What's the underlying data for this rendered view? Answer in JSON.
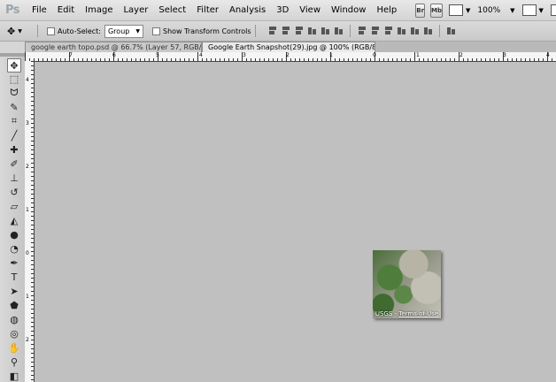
{
  "app": {
    "logo": "Ps"
  },
  "menu": [
    "File",
    "Edit",
    "Image",
    "Layer",
    "Select",
    "Filter",
    "Analysis",
    "3D",
    "View",
    "Window",
    "Help"
  ],
  "menubar_buttons": {
    "bridge": "Br",
    "minibridge": "Mb"
  },
  "zoom": "100%",
  "options": {
    "auto_select_label": "Auto-Select:",
    "auto_select_value": "Group",
    "show_transform_label": "Show Transform Controls"
  },
  "tabs": [
    {
      "label": "google earth topo.psd @ 66.7% (Layer 57, RGB/8) *",
      "active": false
    },
    {
      "label": "Google Earth Snapshot(29).jpg @ 100% (RGB/8#)",
      "active": true
    }
  ],
  "ruler": {
    "h_labels": [
      "7",
      "6",
      "5",
      "4",
      "3",
      "2",
      "1",
      "0",
      "1",
      "2",
      "3",
      "4"
    ],
    "v_labels": [
      "4",
      "3",
      "2",
      "1",
      "0",
      "1",
      "2"
    ]
  },
  "document": {
    "caption_source": "USGS",
    "caption_sep": " - ",
    "caption_terms": "Terms of Use"
  },
  "tools": [
    {
      "name": "move-tool",
      "glyph": "✥",
      "selected": true
    },
    {
      "name": "marquee-tool",
      "glyph": "⬚"
    },
    {
      "name": "lasso-tool",
      "glyph": "ᗢ"
    },
    {
      "name": "quick-select-tool",
      "glyph": "✎"
    },
    {
      "name": "crop-tool",
      "glyph": "⌗"
    },
    {
      "name": "eyedropper-tool",
      "glyph": "╱"
    },
    {
      "name": "spot-healing-tool",
      "glyph": "✚"
    },
    {
      "name": "brush-tool",
      "glyph": "✐"
    },
    {
      "name": "clone-stamp-tool",
      "glyph": "⊥"
    },
    {
      "name": "history-brush-tool",
      "glyph": "↺"
    },
    {
      "name": "eraser-tool",
      "glyph": "▱"
    },
    {
      "name": "paint-bucket-tool",
      "glyph": "◭"
    },
    {
      "name": "blur-tool",
      "glyph": "●"
    },
    {
      "name": "dodge-tool",
      "glyph": "◔"
    },
    {
      "name": "pen-tool",
      "glyph": "✒"
    },
    {
      "name": "type-tool",
      "glyph": "T"
    },
    {
      "name": "path-selection-tool",
      "glyph": "➤"
    },
    {
      "name": "shape-tool",
      "glyph": "⬟"
    },
    {
      "name": "3d-rotate-tool",
      "glyph": "◍"
    },
    {
      "name": "3d-orbit-tool",
      "glyph": "◎"
    },
    {
      "name": "hand-tool",
      "glyph": "✋"
    },
    {
      "name": "zoom-tool",
      "glyph": "⚲"
    },
    {
      "name": "color-swatches",
      "glyph": "◧"
    }
  ]
}
